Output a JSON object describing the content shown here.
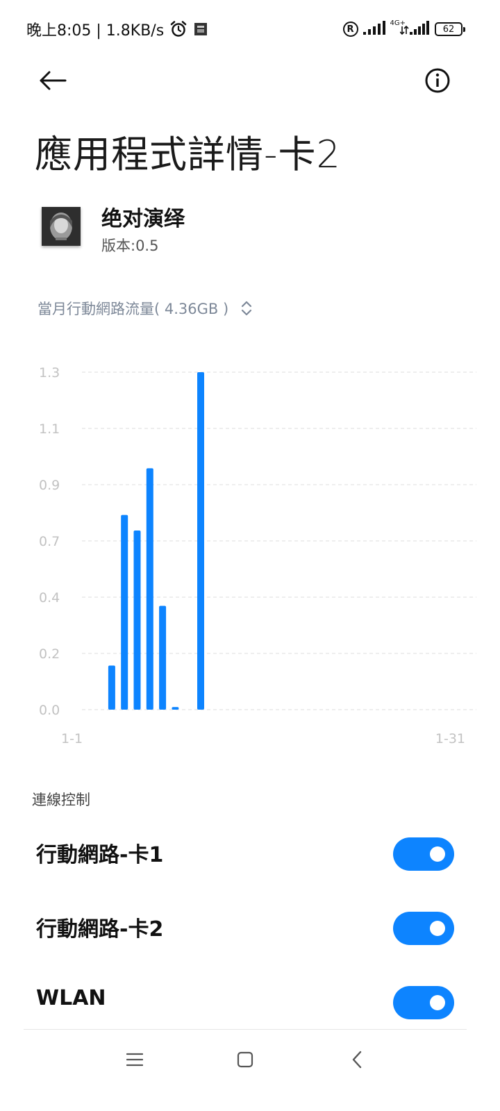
{
  "status_bar": {
    "time": "晚上8:05 | 1.8KB/s",
    "network_type": "4G+",
    "battery": "62"
  },
  "header": {
    "title": "應用程式詳情-卡2"
  },
  "app": {
    "name": "绝对演绎",
    "version": "版本:0.5"
  },
  "usage_selector": {
    "label": "當月行動網路流量( 4.36GB )"
  },
  "chart_data": {
    "type": "bar",
    "yticks": [
      "1.3",
      "1.1",
      "0.9",
      "0.7",
      "0.4",
      "0.2",
      "0.0"
    ],
    "ylim": [
      0,
      1.3
    ],
    "xlim": [
      1,
      31
    ],
    "x_labels": {
      "start": "1-1",
      "end": "1-31"
    },
    "grid": true,
    "color": "#0d84ff",
    "bars": [
      {
        "day": 4,
        "value": 0.17
      },
      {
        "day": 5,
        "value": 0.75
      },
      {
        "day": 6,
        "value": 0.69
      },
      {
        "day": 7,
        "value": 0.93
      },
      {
        "day": 8,
        "value": 0.4
      },
      {
        "day": 9,
        "value": 0.01
      },
      {
        "day": 11,
        "value": 1.3
      }
    ]
  },
  "connection_control": {
    "header": "連線控制",
    "items": [
      {
        "label": "行動網路-卡1",
        "enabled": true
      },
      {
        "label": "行動網路-卡2",
        "enabled": true
      },
      {
        "label": "WLAN",
        "enabled": true
      }
    ]
  },
  "colors": {
    "accent": "#0d84ff",
    "muted_text": "#7d8898",
    "grid": "#dcdcdc"
  }
}
